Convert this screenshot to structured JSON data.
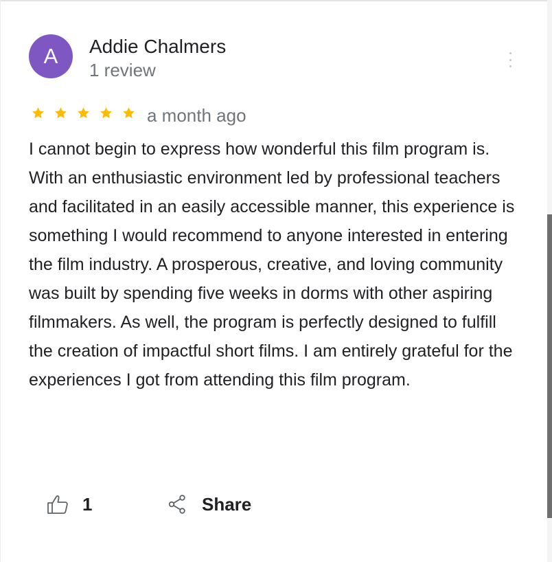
{
  "reviewer": {
    "initial": "A",
    "name": "Addie Chalmers",
    "review_count": "1 review",
    "avatar_color": "#7e57c2"
  },
  "review": {
    "rating": 5,
    "rating_max": 5,
    "star_color": "#fbbc04",
    "date": "a month ago",
    "text": "I cannot begin to express how wonderful this film program is. With an enthusiastic environment led by professional teachers and facilitated in an easily accessible manner, this experience is something I would recommend to anyone interested in entering the film industry. A prosperous, creative, and loving community was built by spending five weeks in dorms with other aspiring filmmakers. As well, the program is perfectly designed to fulfill the creation of impactful short films. I am entirely grateful for the experiences I got from attending this film program."
  },
  "actions": {
    "like_icon": "thumbs-up-icon",
    "like_count": "1",
    "share_icon": "share-icon",
    "share_label": "Share",
    "more_icon": "more-vertical-icon"
  }
}
